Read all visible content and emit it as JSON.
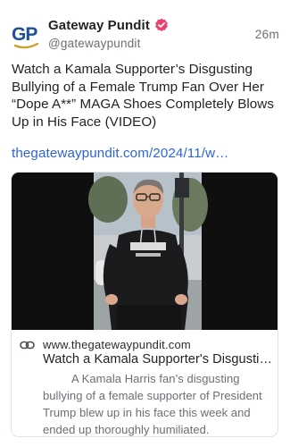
{
  "post": {
    "author": {
      "display_name": "Gateway Pundit",
      "handle": "@gatewaypundit",
      "avatar_text": "GP",
      "verified": true
    },
    "timestamp": "26m",
    "text": "Watch a Kamala Supporter’s Disgusting Bullying of a Female Trump Fan Over Her “Dope A**” MAGA Shoes Completely Blows Up in His Face (VIDEO)",
    "link": "thegatewaypundit.com/2024/11/w…",
    "card": {
      "domain": "www.thegatewaypundit.com",
      "title": "Watch a Kamala Supporter's Disgusti…",
      "description": "A Kamala Harris fan’s disgusting bullying of a female supporter of President Trump blew up in his face this week and ended up thoroughly humiliated."
    }
  },
  "colors": {
    "link": "#2f63d8",
    "verified_badge": "#e8436b",
    "avatar_blue": "#1f4e9c",
    "avatar_gold": "#c9a227",
    "text_primary": "#1f2125",
    "text_secondary": "#6b6e74"
  },
  "icons": {
    "verified": "verified-badge-icon",
    "link": "link-chain-icon"
  }
}
